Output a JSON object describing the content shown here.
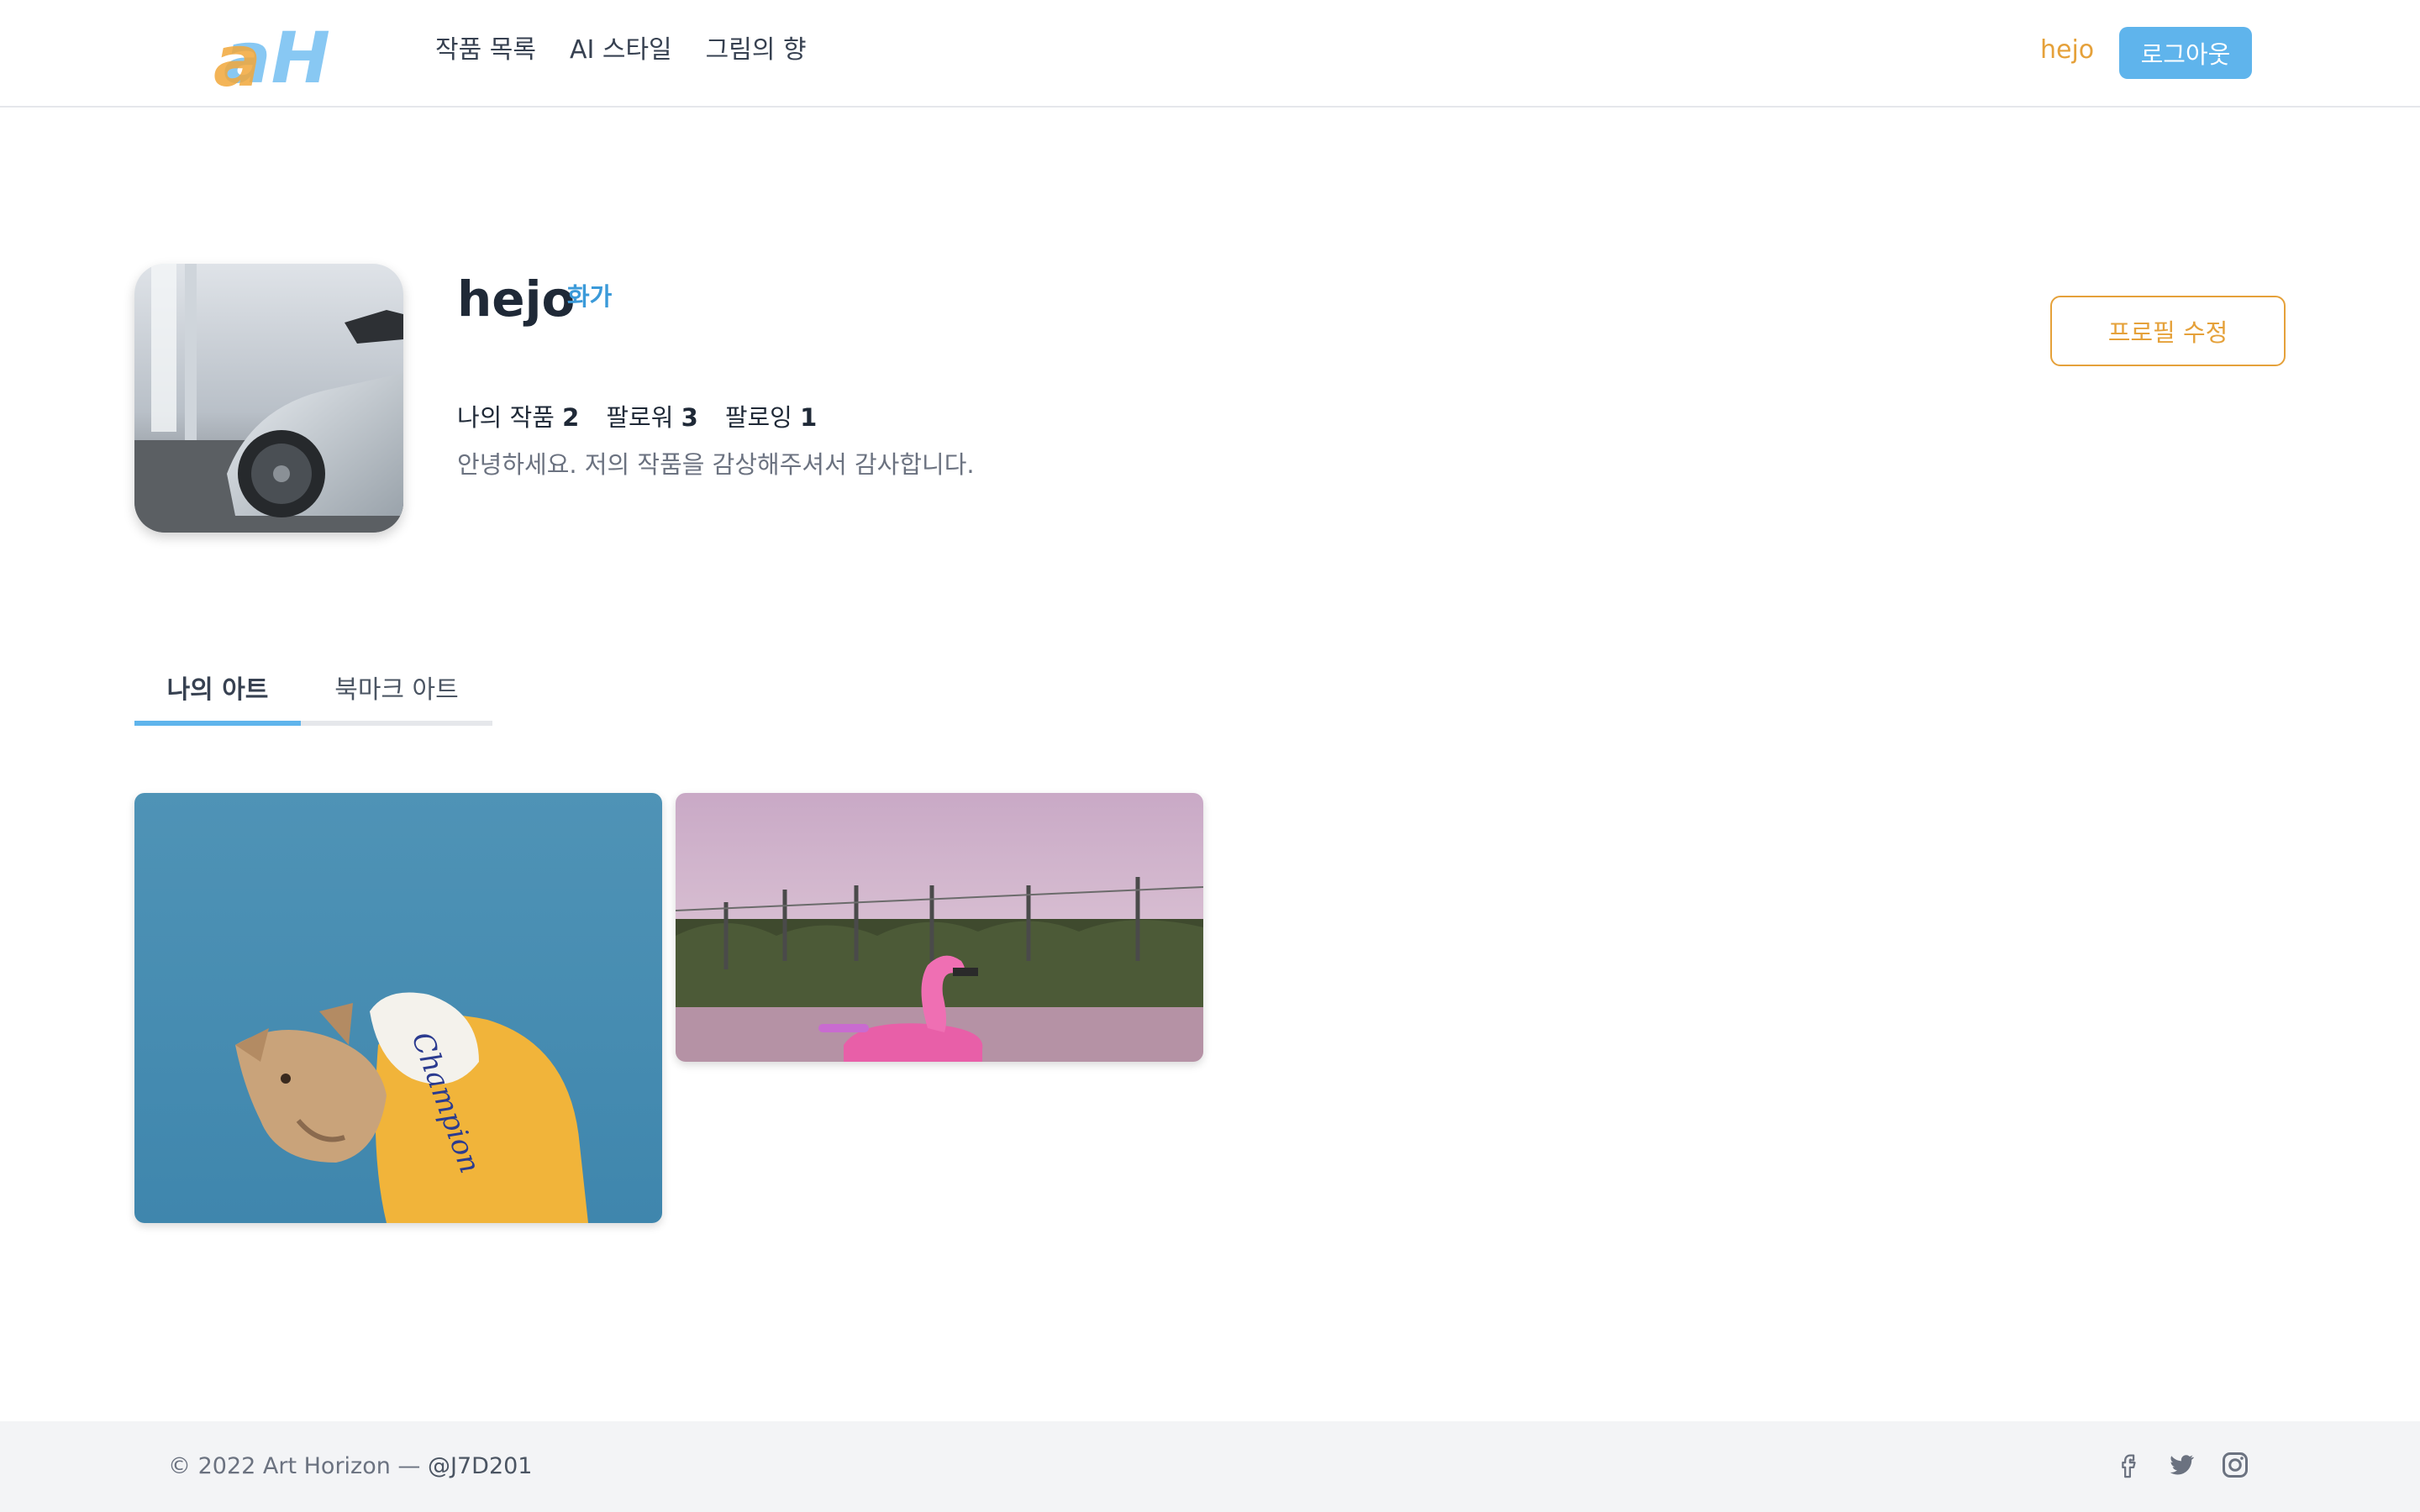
{
  "header": {
    "logo_text": "aH",
    "nav": [
      {
        "label": "작품 목록"
      },
      {
        "label": "AI 스타일"
      },
      {
        "label": "그림의 향"
      }
    ],
    "user_name": "hejo",
    "logout_label": "로그아웃"
  },
  "profile": {
    "name": "hejo",
    "role": "화가",
    "stats": [
      {
        "label": "나의 작품",
        "value": "2"
      },
      {
        "label": "팔로워",
        "value": "3"
      },
      {
        "label": "팔로잉",
        "value": "1"
      }
    ],
    "bio": "안녕하세요. 저의 작품을 감상해주셔서 감사합니다.",
    "edit_label": "프로필 수정"
  },
  "tabs": [
    {
      "label": "나의 아트",
      "active": true
    },
    {
      "label": "북마크 아트",
      "active": false
    }
  ],
  "gallery": [
    {
      "subject": "dog in yellow hoodie"
    },
    {
      "subject": "pink flamingo float by pool"
    }
  ],
  "footer": {
    "copyright": "© 2022 Art Horizon — ",
    "handle": "@J7D201",
    "social_icons": [
      "facebook-icon",
      "twitter-icon",
      "instagram-icon"
    ]
  },
  "colors": {
    "accent_blue": "#5fb4ec",
    "accent_orange": "#e5a13a"
  }
}
